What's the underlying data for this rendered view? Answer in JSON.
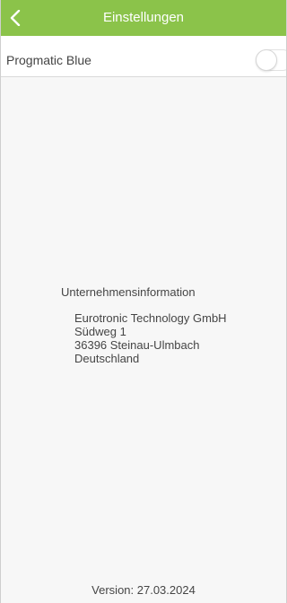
{
  "header": {
    "title": "Einstellungen",
    "back_icon": "chevron-left-icon",
    "color": "#8bc34a"
  },
  "settings": {
    "progmatic_blue": {
      "label": "Progmatic Blue",
      "enabled": false
    }
  },
  "company": {
    "heading": "Unternehmensinformation",
    "name": "Eurotronic Technology GmbH",
    "street": "Südweg 1",
    "city": "36396 Steinau-Ulmbach",
    "country": "Deutschland"
  },
  "footer": {
    "version": "Version: 27.03.2024"
  }
}
